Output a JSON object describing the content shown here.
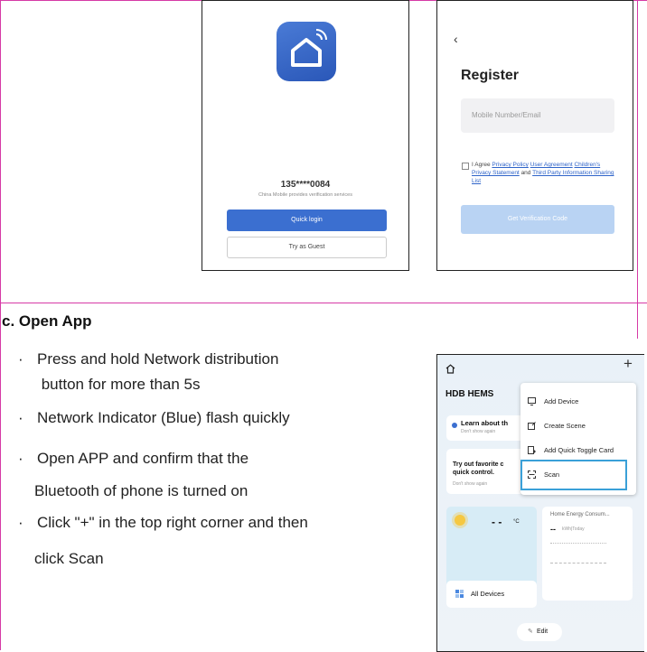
{
  "login_screen": {
    "phone_number": "135****0084",
    "carrier_note": "China Mobile provides verification services",
    "quick_login_label": "Quick login",
    "guest_label": "Try as Guest"
  },
  "register_screen": {
    "back_label": "‹",
    "title": "Register",
    "input_placeholder": "Mobile Number/Email",
    "agree_prefix": "I Agree",
    "link_privacy": "Privacy Policy",
    "link_user_agreement": "User Agreement",
    "link_children": "Children's Privacy Statement",
    "agree_and": "and",
    "link_third_party": "Third Party Information Sharing List",
    "verify_button": "Get Verification Code"
  },
  "instructions": {
    "heading": "c. Open App",
    "bullets": [
      {
        "marker": "·",
        "lines": [
          "Press and hold Network distribution",
          " button for more than 5s"
        ]
      },
      {
        "marker": "·",
        "lines": [
          "Network Indicator (Blue) flash quickly"
        ]
      },
      {
        "marker": "·",
        "lines": [
          "Open APP and confirm that the",
          "Bluetooth of phone is turned on"
        ]
      },
      {
        "marker": "·",
        "lines": [
          "Click \"+\" in the top right corner and then",
          "click Scan"
        ]
      }
    ]
  },
  "home_screen": {
    "home_name": "HDB HEMS",
    "plus_label": "+",
    "learn_title": "Learn about th",
    "learn_sub": "Don't show again",
    "tryout_title_1": "Try out favorite c",
    "tryout_title_2": "quick control.",
    "tryout_sub": "Don't show again",
    "weather_value": "- -",
    "weather_unit": "°C",
    "energy_title": "Home Energy Consum...",
    "energy_value": "--",
    "energy_unit": "kWh|Today",
    "all_devices_label": "All Devices",
    "edit_label": "Edit",
    "menu": [
      {
        "icon": "add-device-icon",
        "label": "Add Device"
      },
      {
        "icon": "create-scene-icon",
        "label": "Create Scene"
      },
      {
        "icon": "quick-toggle-icon",
        "label": "Add Quick Toggle Card"
      },
      {
        "icon": "scan-icon",
        "label": "Scan"
      }
    ],
    "highlight_color": "#3aa0d8"
  }
}
